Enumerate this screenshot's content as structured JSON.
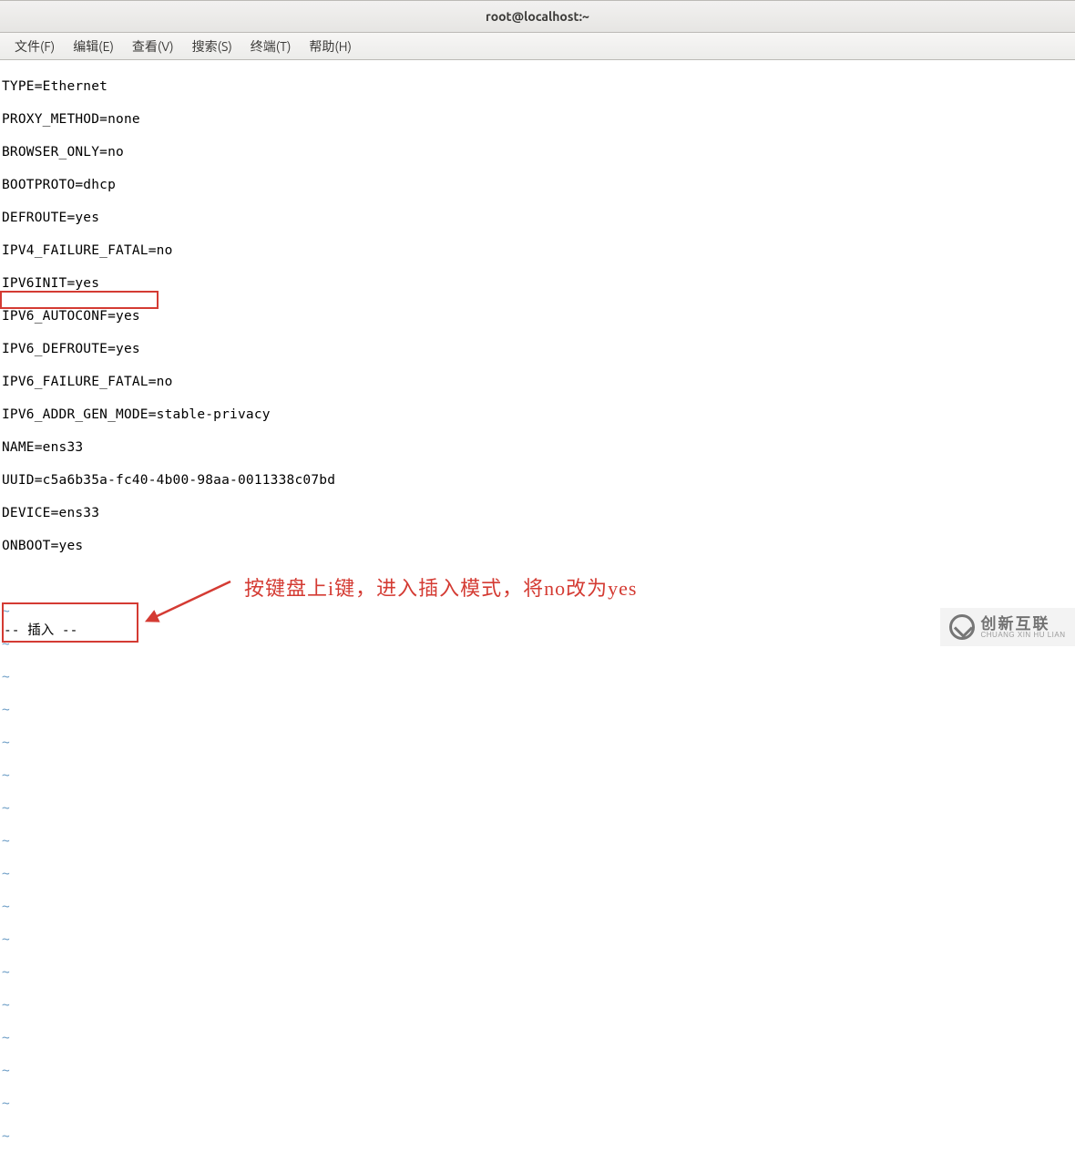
{
  "window": {
    "title": "root@localhost:~"
  },
  "menu": {
    "file": "文件(F)",
    "edit": "编辑(E)",
    "view": "查看(V)",
    "search": "搜索(S)",
    "terminal": "终端(T)",
    "help": "帮助(H)"
  },
  "config": {
    "l1": "TYPE=Ethernet",
    "l2": "PROXY_METHOD=none",
    "l3": "BROWSER_ONLY=no",
    "l4": "BOOTPROTO=dhcp",
    "l5": "DEFROUTE=yes",
    "l6": "IPV4_FAILURE_FATAL=no",
    "l7": "IPV6INIT=yes",
    "l8": "IPV6_AUTOCONF=yes",
    "l9": "IPV6_DEFROUTE=yes",
    "l10": "IPV6_FAILURE_FATAL=no",
    "l11": "IPV6_ADDR_GEN_MODE=stable-privacy",
    "l12": "NAME=ens33",
    "l13": "UUID=c5a6b35a-fc40-4b00-98aa-0011338c07bd",
    "l14": "DEVICE=ens33",
    "l15": "ONBOOT=yes"
  },
  "tilde": "~",
  "status": {
    "insert": "-- 插入 --"
  },
  "annotation": {
    "text": "按键盘上i键，进入插入模式，将no改为yes"
  },
  "watermark": {
    "cn": "创新互联",
    "en": "CHUANG XIN HU LIAN"
  }
}
